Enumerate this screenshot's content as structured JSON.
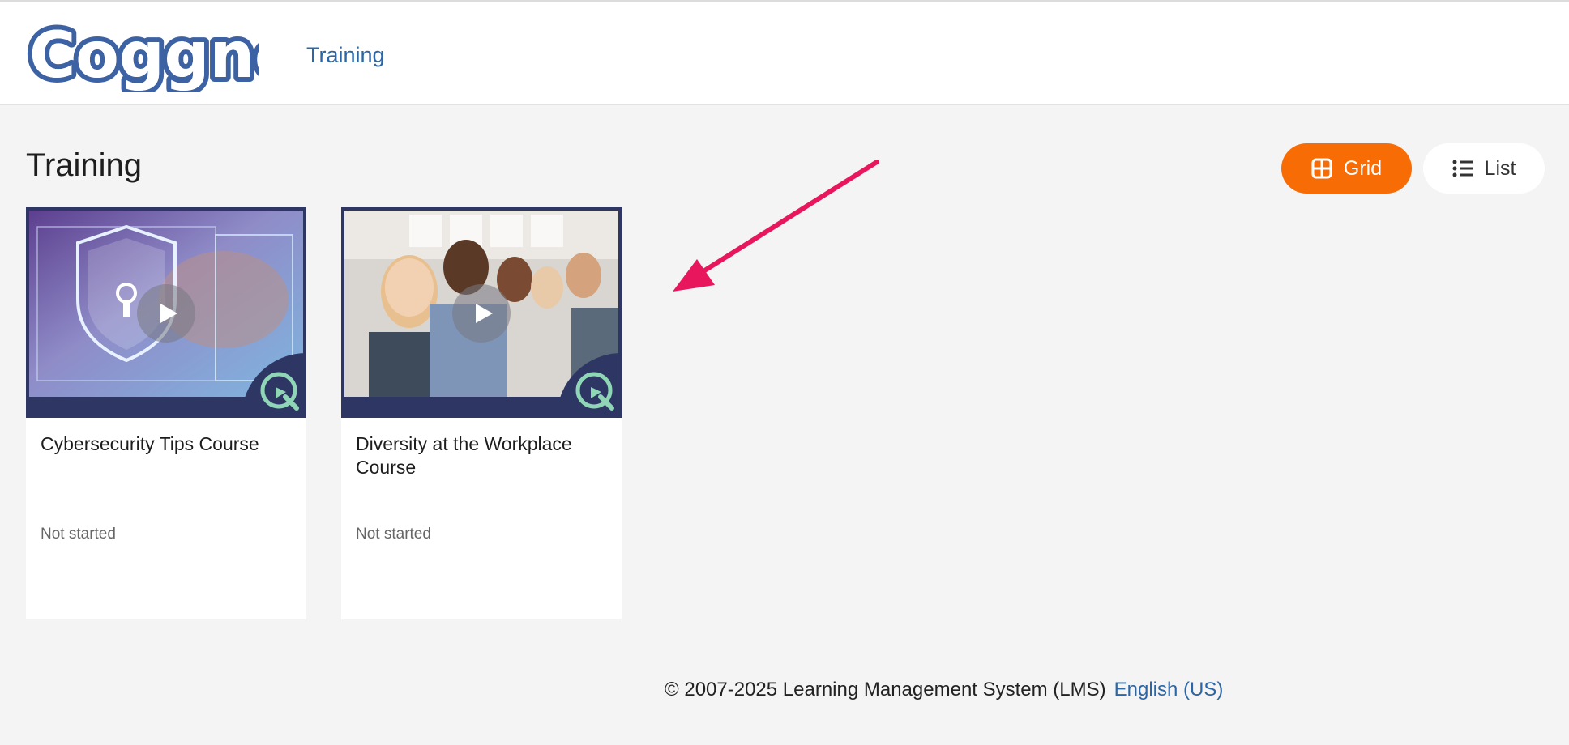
{
  "header": {
    "logo_text": "Coggno",
    "nav": {
      "training_label": "Training"
    }
  },
  "main": {
    "title": "Training",
    "view_toggle": {
      "grid_label": "Grid",
      "list_label": "List",
      "active": "Grid",
      "active_color": "#f86c06"
    },
    "courses": [
      {
        "title": "Cybersecurity Tips Course",
        "status": "Not started",
        "thumbnail": "shield-lock-thumbnail"
      },
      {
        "title": "Diversity at the Workplace Course",
        "status": "Not started",
        "thumbnail": "team-selfie-thumbnail"
      }
    ]
  },
  "footer": {
    "copyright": "© 2007-2025 Learning Management System (LMS)",
    "language_link": "English (US)"
  },
  "colors": {
    "brand_blue": "#2b66a6",
    "accent_orange": "#f86c06",
    "annotation_arrow": "#e8175d"
  }
}
